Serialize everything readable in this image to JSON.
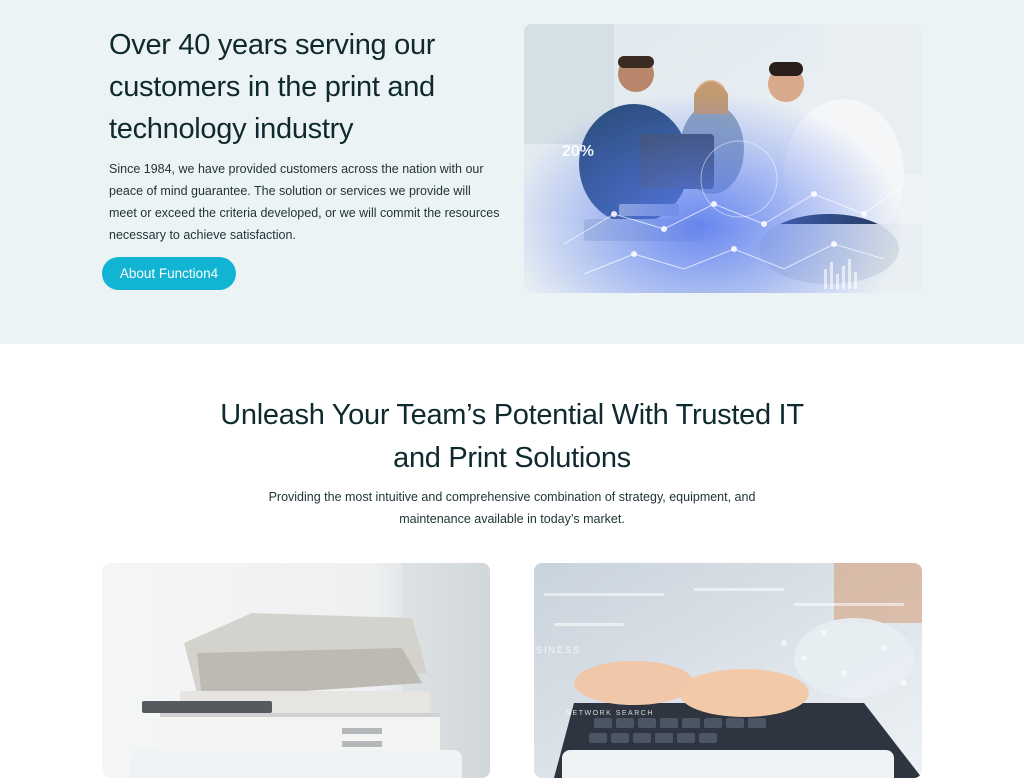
{
  "hero": {
    "title": "Over 40 years serving our customers in the print and technology industry",
    "text": "Since 1984, we have provided customers across the nation with our peace of mind guarantee. The solution or services we provide will meet or exceed the criteria developed, or we will commit the resources necessary to achieve satisfaction.",
    "cta_label": "About Function4",
    "photo_overlay_text": "20%"
  },
  "section": {
    "title": "Unleash Your Team’s Potential With Trusted IT and Print Solutions",
    "subtitle": "Providing the most intuitive and comprehensive combination of strategy, equipment, and maintenance available in today’s market."
  },
  "cards": [
    {
      "image": "office-printer-photo"
    },
    {
      "image": "typing-network-photo",
      "overlay_text_1": "SINESS",
      "overlay_text_2": "NETWORK SEARCH"
    }
  ],
  "colors": {
    "accent": "#12b4d4",
    "hero_bg": "#ecf3f5",
    "heading": "#0f2a2e"
  }
}
